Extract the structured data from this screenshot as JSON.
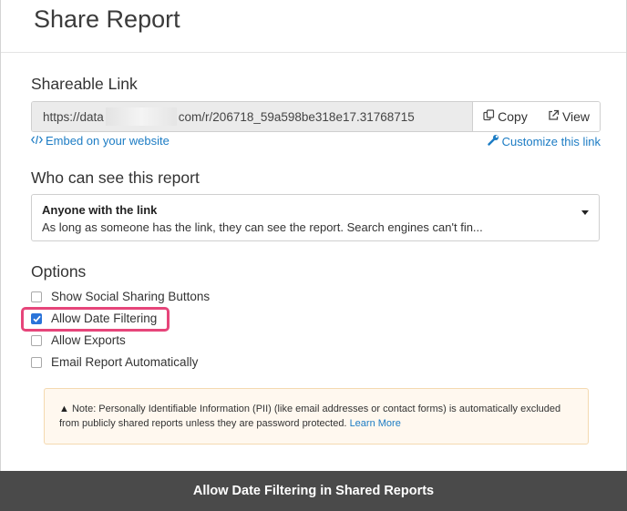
{
  "modal": {
    "title": "Share Report"
  },
  "shareable_link": {
    "section_title": "Shareable Link",
    "url_start": "https://data",
    "url_end": "com/r/206718_59a598be318e17.31768715",
    "copy_label": "Copy",
    "view_label": "View",
    "embed_label": "Embed on your website",
    "customize_label": "Customize this link"
  },
  "visibility": {
    "section_title": "Who can see this report",
    "selected_title": "Anyone with the link",
    "selected_description": "As long as someone has the link, they can see the report. Search engines can't fin..."
  },
  "options": {
    "section_title": "Options",
    "items": [
      {
        "label": "Show Social Sharing Buttons",
        "checked": false
      },
      {
        "label": "Allow Date Filtering",
        "checked": true
      },
      {
        "label": "Allow Exports",
        "checked": false
      },
      {
        "label": "Email Report Automatically",
        "checked": false
      }
    ]
  },
  "note": {
    "prefix": "Note: Personally Identifiable Information (PII) (like email addresses or contact forms) is automatically excluded from publicly shared reports unless they are password protected.",
    "link_label": "Learn More"
  },
  "caption": "Allow Date Filtering in Shared Reports",
  "colors": {
    "accent_link": "#1c7cc4",
    "checkbox_checked": "#2b74d9",
    "highlight": "#e6457a",
    "caption_bg": "#4a4a4a"
  }
}
